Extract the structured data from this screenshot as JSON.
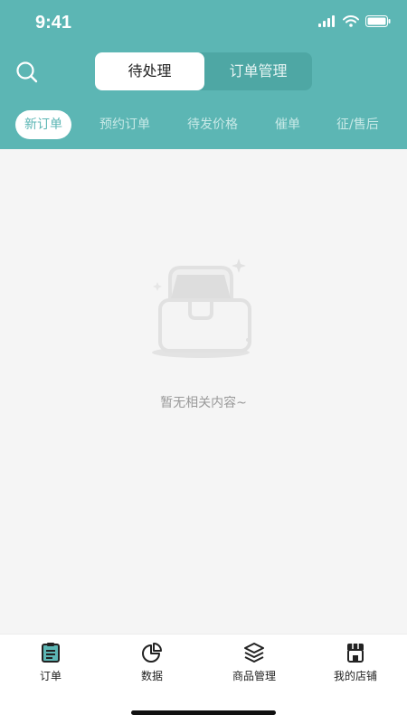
{
  "status": {
    "time": "9:41"
  },
  "header": {
    "segments": [
      "待处理",
      "订单管理"
    ],
    "tabs": [
      "新订单",
      "预约订单",
      "待发价格",
      "催单",
      "征/售后"
    ]
  },
  "empty": {
    "message": "暂无相关内容~"
  },
  "tabbar": {
    "items": [
      {
        "label": "订单",
        "icon": "order-clipboard-icon"
      },
      {
        "label": "数据",
        "icon": "pie-chart-icon"
      },
      {
        "label": "商品管理",
        "icon": "layers-icon"
      },
      {
        "label": "我的店铺",
        "icon": "store-icon"
      }
    ]
  },
  "colors": {
    "primary": "#5cb6b4",
    "segment_bg": "#4ea7a4",
    "background": "#f5f5f5"
  }
}
